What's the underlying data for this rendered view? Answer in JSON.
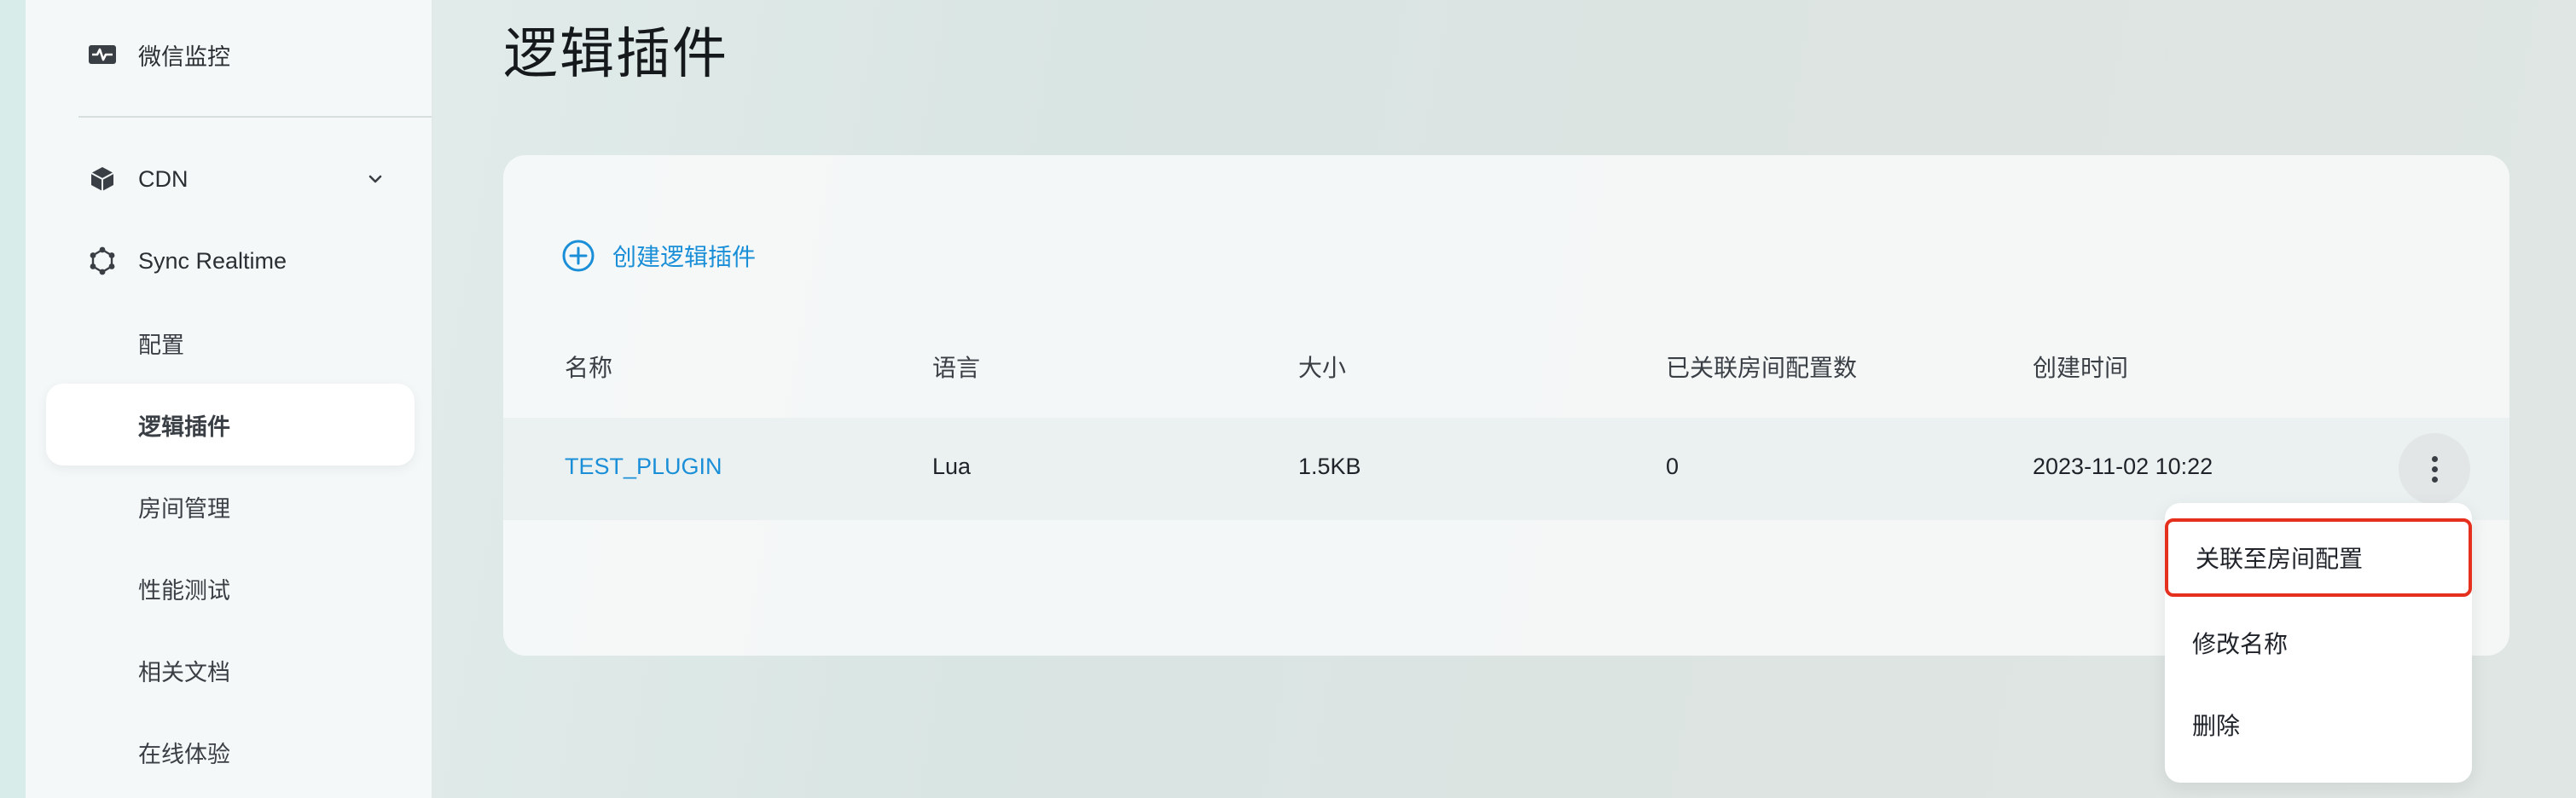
{
  "sidebar": {
    "items": [
      {
        "label": "微信监控",
        "icon": "pulse-monitor-icon"
      },
      {
        "label": "CDN",
        "icon": "cube-icon",
        "expand": "chevron-down-icon"
      },
      {
        "label": "Sync Realtime",
        "icon": "hexagon-nodes-icon"
      }
    ],
    "sub_items": [
      {
        "label": "配置"
      },
      {
        "label": "逻辑插件",
        "active": true
      },
      {
        "label": "房间管理"
      },
      {
        "label": "性能测试"
      },
      {
        "label": "相关文档"
      },
      {
        "label": "在线体验"
      }
    ]
  },
  "page": {
    "title": "逻辑插件"
  },
  "toolbar": {
    "create_label": "创建逻辑插件",
    "create_icon": "plus-circle-icon"
  },
  "table": {
    "columns": [
      "名称",
      "语言",
      "大小",
      "已关联房间配置数",
      "创建时间"
    ],
    "rows": [
      {
        "name": "TEST_PLUGIN",
        "language": "Lua",
        "size": "1.5KB",
        "linked_count": "0",
        "created": "2023-11-02 10:22"
      }
    ],
    "row_action_icon": "more-vertical-icon"
  },
  "context_menu": {
    "items": [
      "关联至房间配置",
      "修改名称",
      "删除"
    ]
  },
  "colors": {
    "accent": "#1a8fd8",
    "highlight_border": "#e6301e"
  }
}
